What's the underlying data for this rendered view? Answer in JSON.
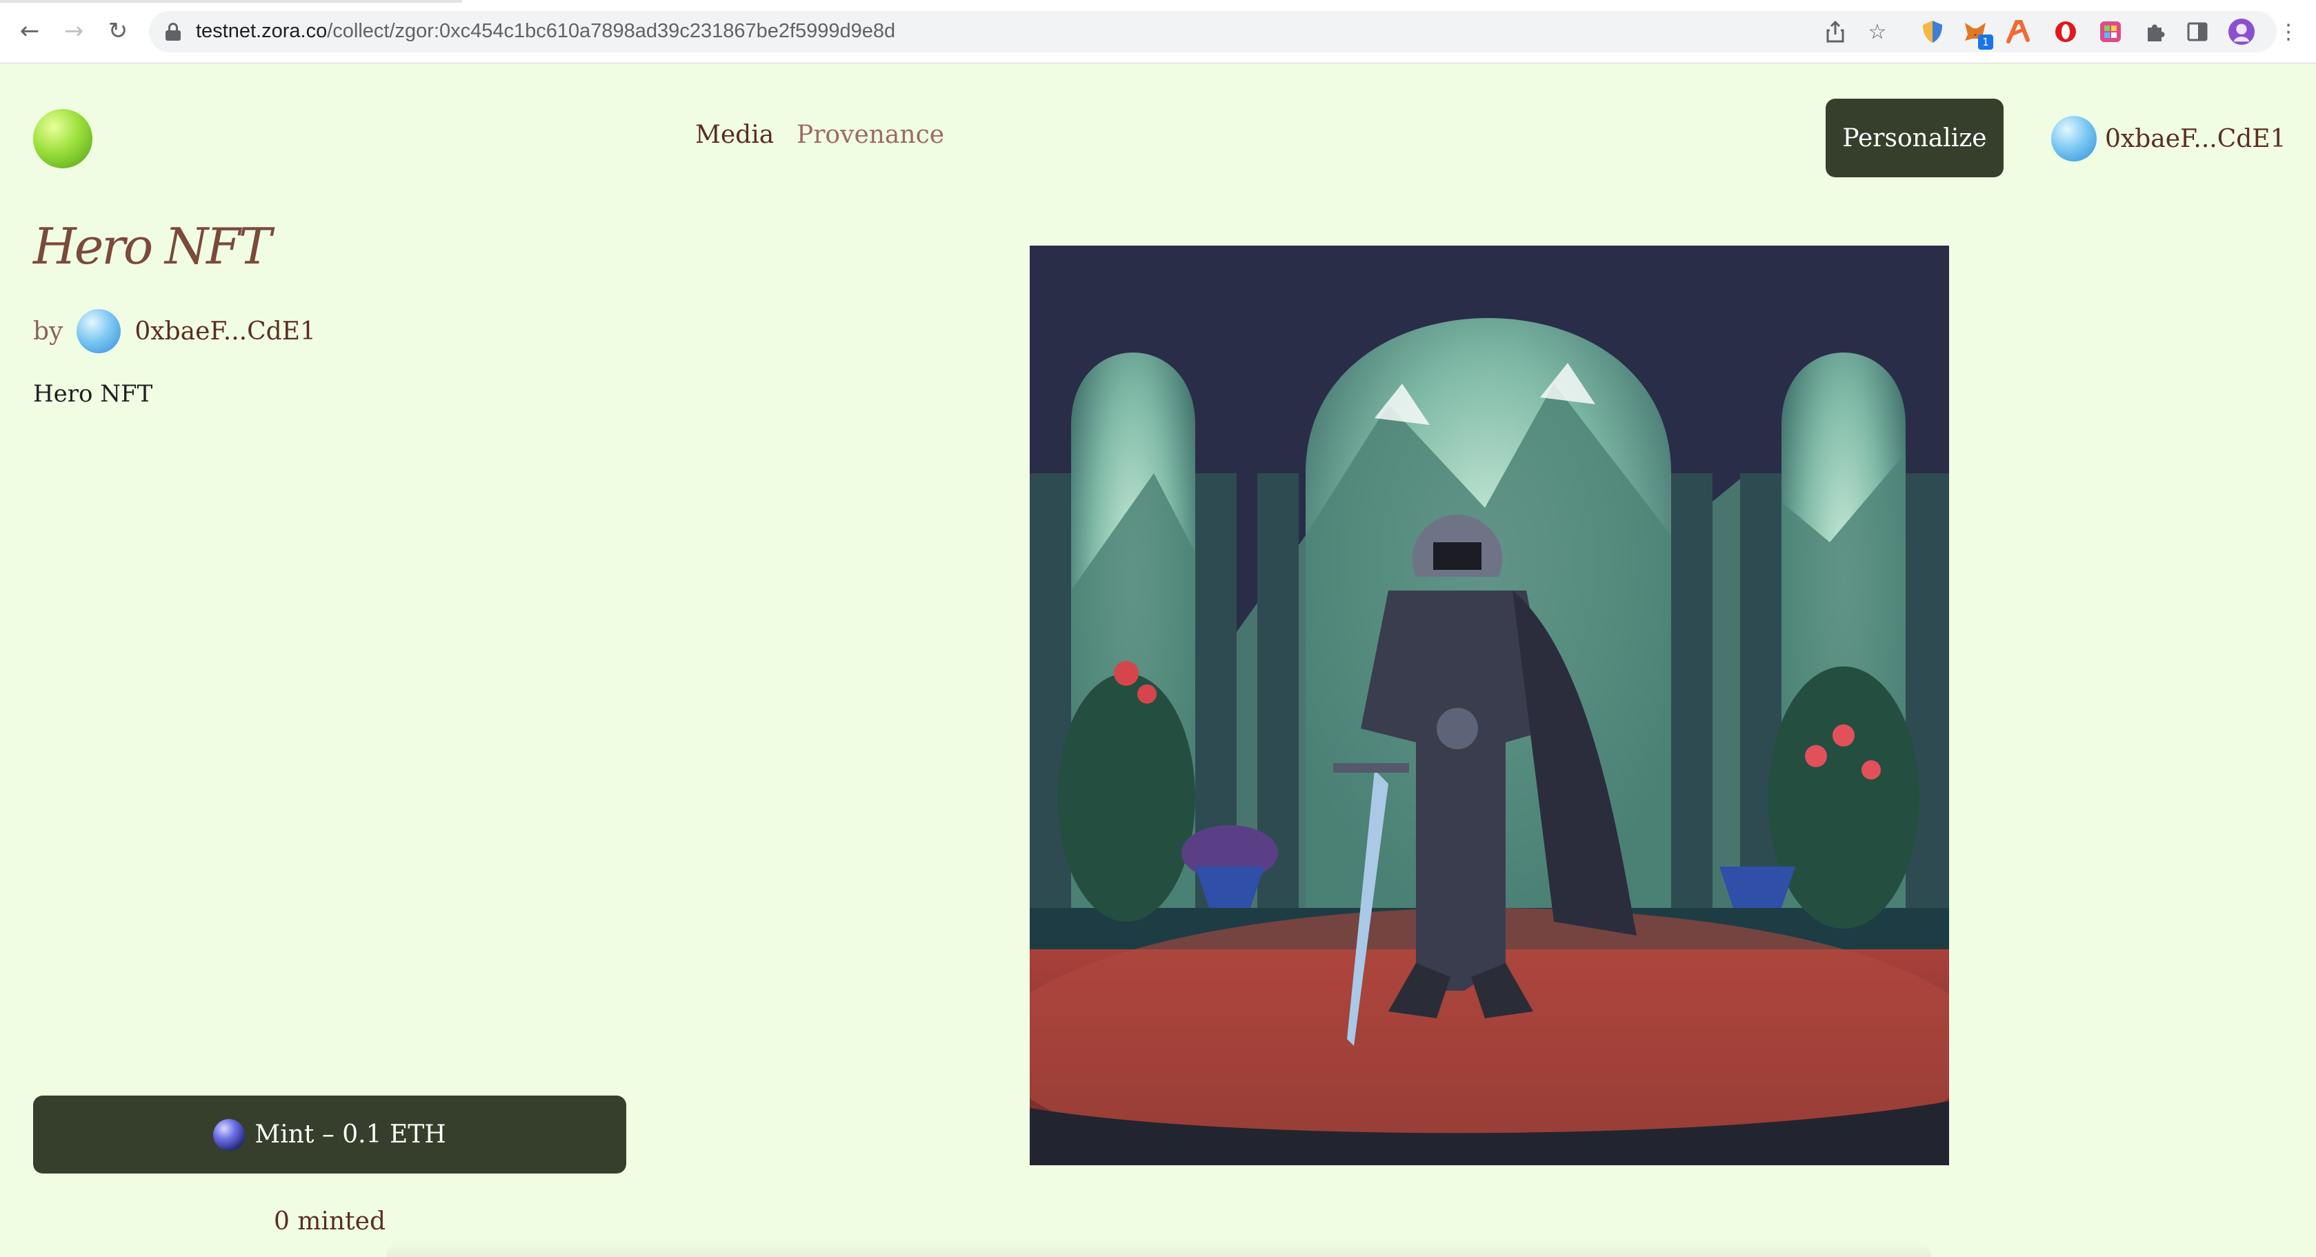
{
  "browser": {
    "url_host": "testnet.zora.co",
    "url_path": "/collect/zgor:0xc454c1bc610a7898ad39c231867be2f5999d9e8d",
    "extension_badge": "1",
    "icons": [
      "back-icon",
      "forward-icon",
      "reload-icon",
      "lock-icon",
      "share-icon",
      "star-icon",
      "extensions-icon",
      "side-panel-icon",
      "menu-icon"
    ]
  },
  "header": {
    "nav": [
      "Media",
      "Provenance"
    ],
    "personalize_label": "Personalize",
    "account_label": "0xbaeF...CdE1"
  },
  "token": {
    "title": "Hero NFT",
    "by_label": "by",
    "creator": "0xbaeF...CdE1",
    "description": "Hero NFT"
  },
  "mint": {
    "button_label": "Mint – 0.1 ETH",
    "minted_count": "0 minted"
  },
  "colors": {
    "page_background": "#f1fde3",
    "button_background": "#353f2b",
    "text_brown": "#5a2f1f"
  }
}
